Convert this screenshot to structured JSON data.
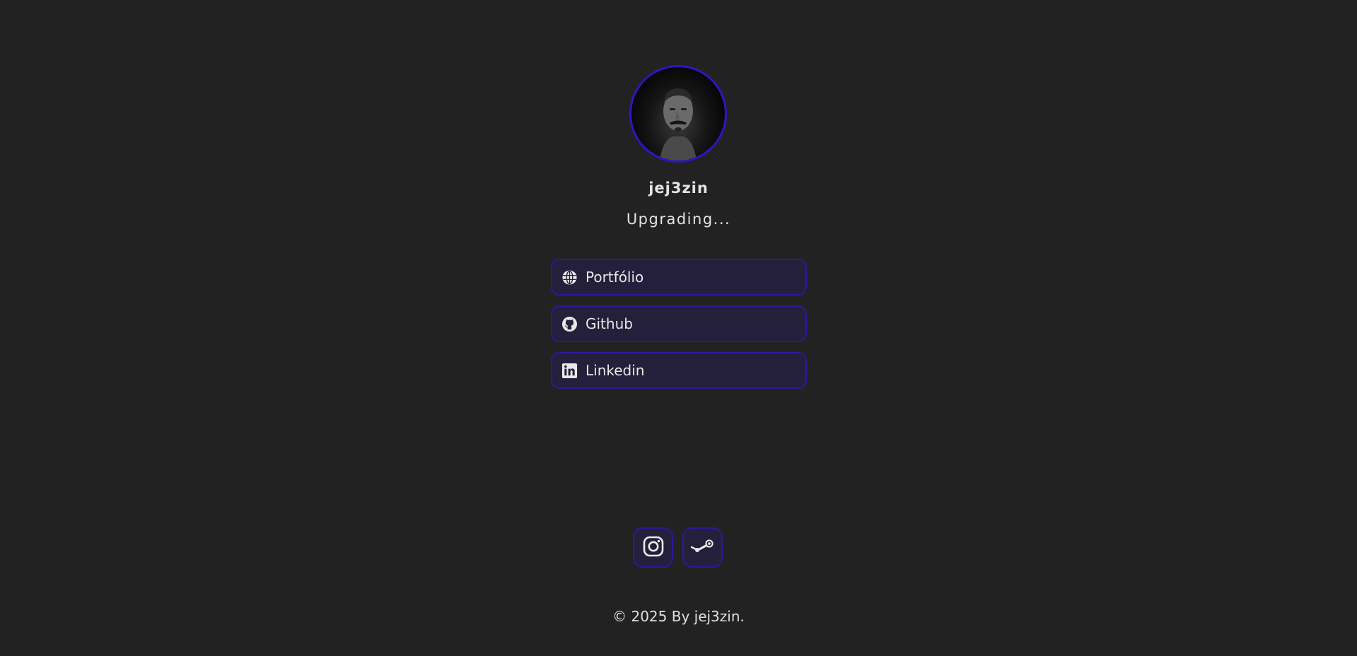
{
  "profile": {
    "username": "jej3zin",
    "status": "Upgrading..."
  },
  "links": [
    {
      "label": "Portfólio",
      "icon": "globe-icon"
    },
    {
      "label": "Github",
      "icon": "github-icon"
    },
    {
      "label": "Linkedin",
      "icon": "linkedin-icon"
    }
  ],
  "socials": [
    {
      "icon": "instagram-icon"
    },
    {
      "icon": "steam-icon"
    }
  ],
  "footer": {
    "text": "© 2025 By jej3zin."
  },
  "colors": {
    "background": "#222222",
    "accent": "#2b1a9c",
    "button_bg": "#241f3b",
    "text": "#e6e6e6"
  }
}
